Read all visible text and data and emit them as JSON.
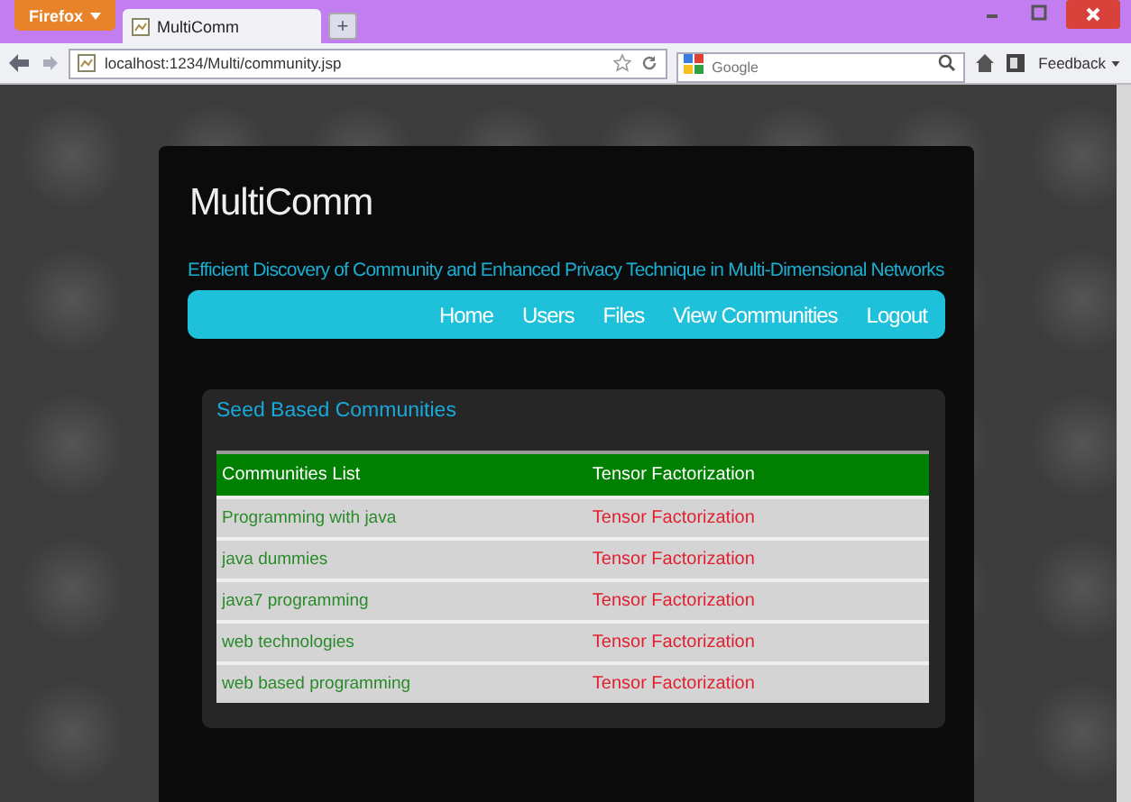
{
  "browser": {
    "menu_button": "Firefox",
    "tabs": [
      {
        "title": "MultiComm",
        "selected": true
      }
    ],
    "new_tab": "+",
    "address": "localhost:1234/Multi/community.jsp",
    "search": {
      "placeholder": "Google"
    },
    "feedback": "Feedback"
  },
  "site": {
    "title": "MultiComm",
    "subtitle": "Efficient Discovery of Community and Enhanced Privacy Technique in Multi-Dimensional Networks",
    "nav": [
      {
        "label": "Home"
      },
      {
        "label": "Users"
      },
      {
        "label": "Files"
      },
      {
        "label": "View Communities"
      },
      {
        "label": "Logout"
      }
    ]
  },
  "panel": {
    "title": "Seed Based Communities",
    "table": {
      "columns": [
        "Communities List",
        "Tensor Factorization"
      ],
      "rows": [
        [
          "Programming with java",
          "Tensor Factorization"
        ],
        [
          "java dummies",
          "Tensor Factorization"
        ],
        [
          "java7 programming",
          "Tensor Factorization"
        ],
        [
          "web technologies",
          "Tensor Factorization"
        ],
        [
          "web based programming",
          "Tensor Factorization"
        ]
      ]
    }
  }
}
